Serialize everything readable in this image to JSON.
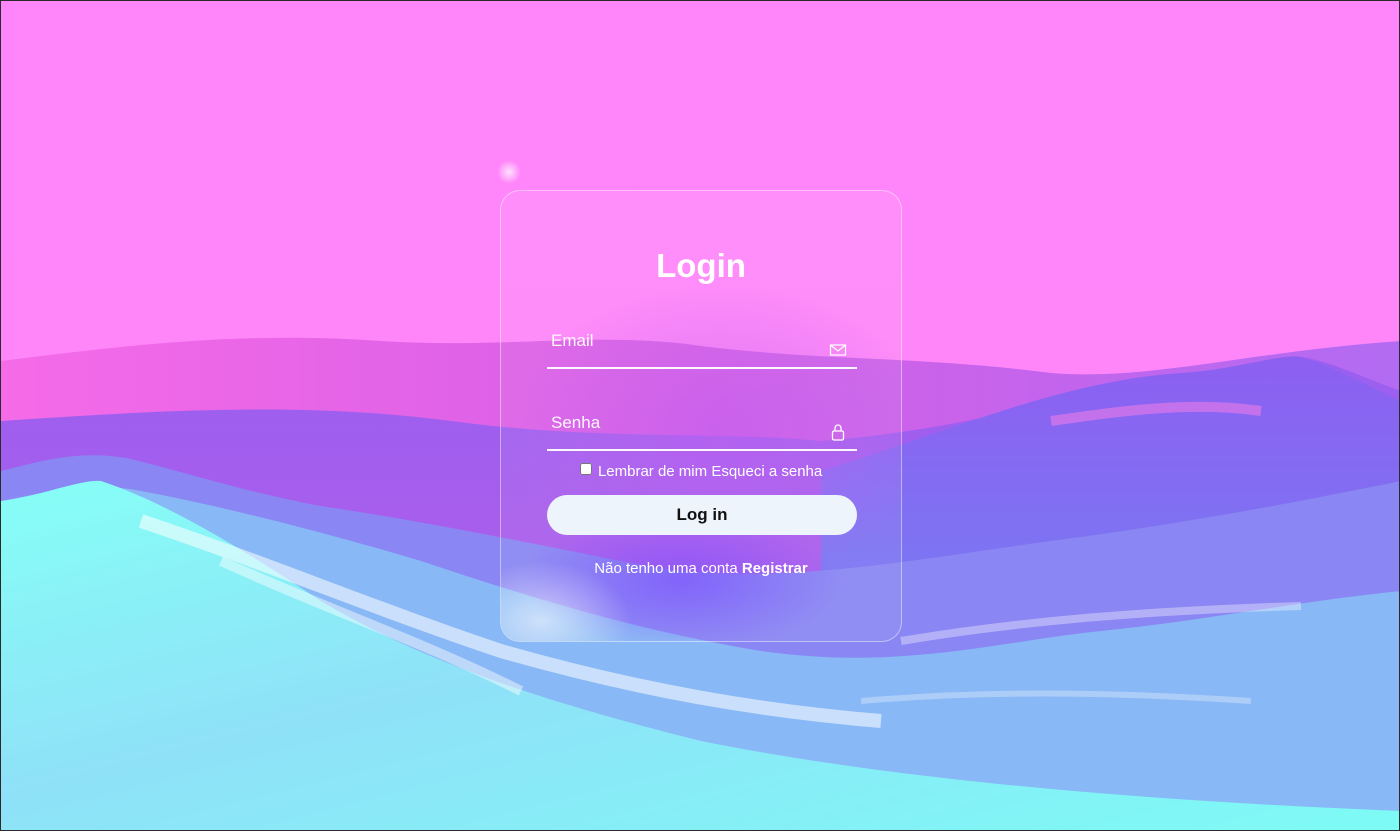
{
  "login": {
    "title": "Login",
    "email_placeholder": "Email",
    "password_placeholder": "Senha",
    "remember_label": "Lembrar de mim",
    "forgot_label": "Esqueci a senha",
    "submit_label": "Log in",
    "no_account_text": "Não tenho uma conta",
    "register_label": "Registrar"
  },
  "icons": {
    "email": "envelope-icon",
    "password": "lock-icon"
  },
  "colors": {
    "sky": "#ff86fb",
    "button_bg": "#eef4fc",
    "text": "#ffffff"
  }
}
